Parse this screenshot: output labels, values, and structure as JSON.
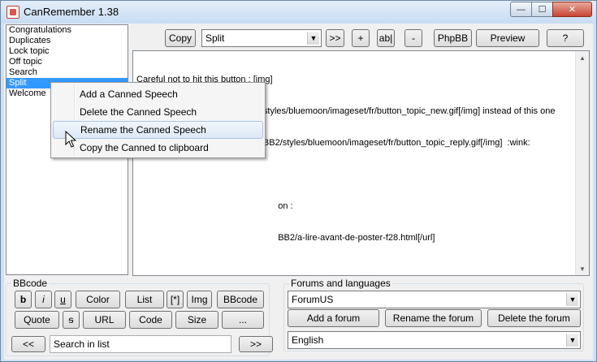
{
  "window": {
    "title": "CanRemember 1.38",
    "min_label": "—",
    "max_label": "☐",
    "close_label": "✕"
  },
  "speech_list": {
    "items": [
      "Congratulations",
      "Duplicates",
      "Lock topic",
      "Off topic",
      "Search",
      "Split",
      "Welcome"
    ],
    "selected": "Split"
  },
  "toolbar": {
    "copy_label": "Copy",
    "speech_select_value": "Split",
    "next_label": ">>",
    "add_label": "+",
    "rename_label": "ab|",
    "remove_label": "-",
    "phpbb_label": "PhpBB",
    "preview_label": "Preview",
    "help_label": "?"
  },
  "editor": {
    "lines": [
      "Careful not to hit this button : [img]",
      "http://www.libellules.ch/phpBB2/styles/bluemoon/imageset/fr/button_topic_new.gif[/img] instead of this one",
      "[img]http://www.libellules.ch/phpBB2/styles/bluemoon/imageset/fr/button_topic_reply.gif[/img]  :wink:",
      "",
      "                                                         on :",
      "                                                         BB2/a-lire-avant-de-poster-f28.html[/url]"
    ]
  },
  "context_menu": {
    "items": [
      "Add a Canned Speech",
      "Delete the Canned Speech",
      "Rename the Canned Speech",
      "Copy the Canned to clipboard"
    ],
    "hovered": "Rename the Canned Speech"
  },
  "bbcode": {
    "title": "BBcode",
    "bold": "b",
    "italic": "i",
    "underline": "u",
    "color": "Color",
    "list": "List",
    "list_item": "[*]",
    "img": "Img",
    "bbcode": "BBcode",
    "quote": "Quote",
    "small": "ᵴ",
    "url": "URL",
    "code": "Code",
    "size": "Size",
    "more": "..."
  },
  "search": {
    "prev": "<<",
    "placeholder": "Search in list",
    "next": ">>"
  },
  "forums": {
    "title": "Forums and languages",
    "forum_value": "ForumUS",
    "add": "Add a forum",
    "rename": "Rename the forum",
    "delete": "Delete the forum",
    "language_value": "English"
  },
  "colors": {
    "selection": "#3399ff",
    "close_button": "#c74534"
  }
}
